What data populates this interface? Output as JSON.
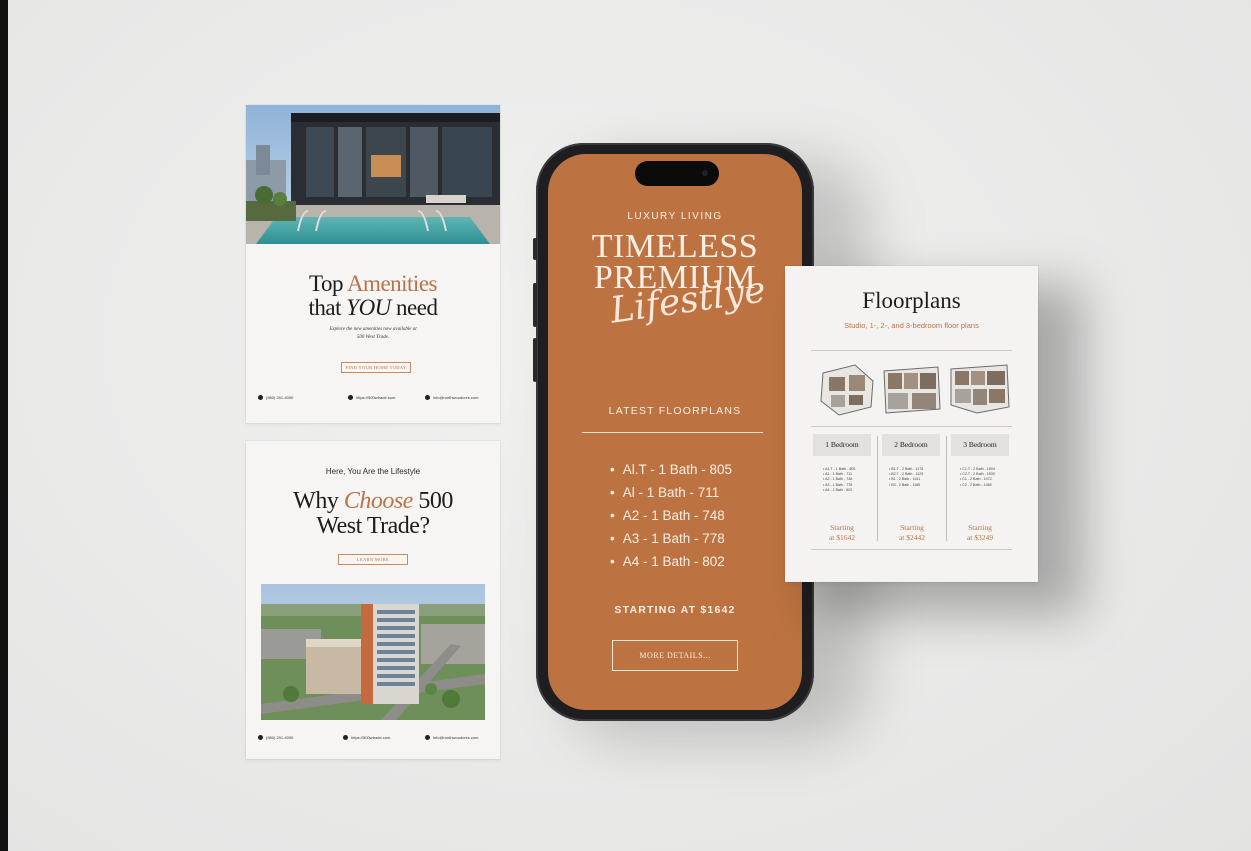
{
  "colors": {
    "accent": "#b8734a",
    "phone_screen": "#bd7341",
    "card_bg": "#f6f5f3"
  },
  "amenities_card": {
    "title_a": "Top ",
    "title_accent": "Amenities",
    "title_b": "that ",
    "title_em": "YOU",
    "title_c": " need",
    "subtitle_line1": "Explore the new amenities now available at",
    "subtitle_line2": "500 West Trade.",
    "button": "FIND YOUR HOME TODAY",
    "phone": "(980) 291-4090",
    "website": "https://500wtrade.com",
    "email": "info@northwoodcres.com"
  },
  "why_card": {
    "kicker": "Here, You Are the Lifestyle",
    "title_a": "Why ",
    "title_accent": "Choose",
    "title_b": " 500",
    "title_line2": "West Trade?",
    "button": "LEARN MORE",
    "phone": "(980) 291-4090",
    "website": "https://500wtrade.com",
    "email": "info@northwoodcres.com"
  },
  "phone_screen": {
    "kicker": "LUXURY LIVING",
    "title_line1": "TIMELESS",
    "title_line2": "PREMIUM",
    "script": "Lifestlye",
    "section": "LATEST FLOORPLANS",
    "floorplans": [
      "Al.T - 1 Bath - 805",
      "Al - 1 Bath - 711",
      "A2 - 1 Bath - 748",
      "A3 - 1 Bath - 778",
      "A4 - 1 Bath - 802"
    ],
    "starting": "STARTING AT $1642",
    "button": "MORE DETAILS..."
  },
  "floorplans_card": {
    "title": "Floorplans",
    "subtitle": "Studio, 1-, 2-, and 3-bedroom floor plans",
    "columns": [
      {
        "head": "1 Bedroom",
        "items": [
          "A1.T - 1 Bath - 805",
          "A1 - 1 Bath - 711",
          "A2 - 1 Bath - 748",
          "A3 - 1 Bath - 778",
          "A4 - 1 Bath - 802"
        ],
        "price_line1": "Starting",
        "price_line2": "at $1642"
      },
      {
        "head": "2 Bedroom",
        "items": [
          "B1.T - 2 Bath - 1175",
          "B2.T - 2 Bath - 1125",
          "B1 - 2 Bath - 1141",
          "B3 - 2 Bath - 1185"
        ],
        "price_line1": "Starting",
        "price_line2": "at $2442"
      },
      {
        "head": "3 Bedroom",
        "items": [
          "C1.T - 2 Bath - 1504",
          "C2.T - 2 Bath - 1530",
          "C1 - 2 Bath - 1472",
          "C2 - 2 Bath - 1465"
        ],
        "price_line1": "Starting",
        "price_line2": "at $3249"
      }
    ]
  }
}
